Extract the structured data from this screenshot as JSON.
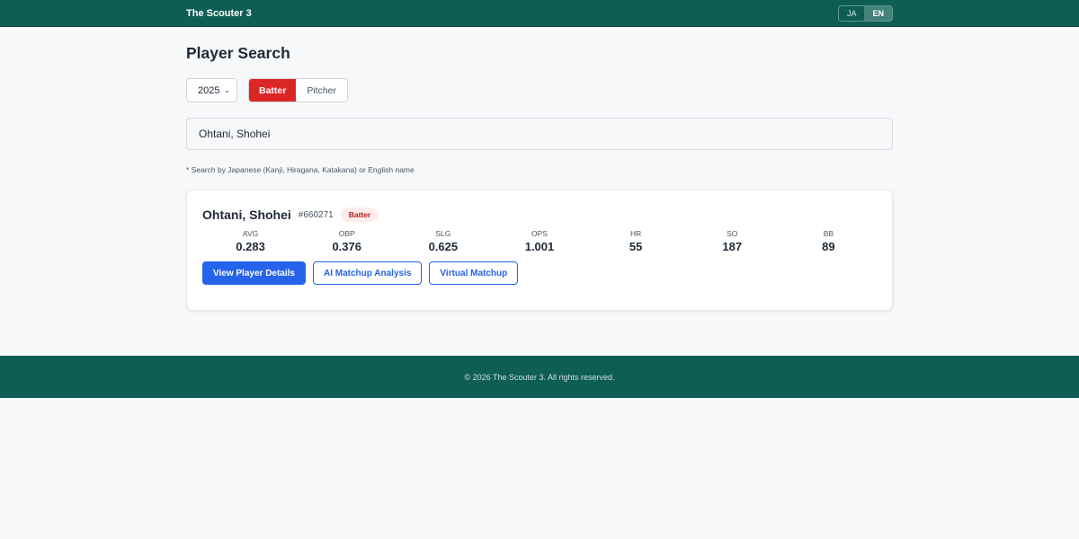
{
  "header": {
    "brand": "The Scouter 3",
    "languages": [
      {
        "label": "JA",
        "active": false
      },
      {
        "label": "EN",
        "active": true
      }
    ]
  },
  "page": {
    "title": "Player Search"
  },
  "controls": {
    "year": "2025",
    "types": [
      {
        "label": "Batter",
        "active": true
      },
      {
        "label": "Pitcher",
        "active": false
      }
    ]
  },
  "search": {
    "value": "Ohtani, Shohei",
    "hint": "* Search by Japanese (Kanji, Hiragana, Katakana) or English name"
  },
  "result": {
    "name": "Ohtani, Shohei",
    "id": "#660271",
    "badge": "Batter",
    "stats": [
      {
        "label": "AVG",
        "value": "0.283"
      },
      {
        "label": "OBP",
        "value": "0.376"
      },
      {
        "label": "SLG",
        "value": "0.625"
      },
      {
        "label": "OPS",
        "value": "1.001"
      },
      {
        "label": "HR",
        "value": "55"
      },
      {
        "label": "SO",
        "value": "187"
      },
      {
        "label": "BB",
        "value": "89"
      }
    ],
    "actions": {
      "details": "View Player Details",
      "ai": "AI Matchup Analysis",
      "virtual": "Virtual Matchup"
    }
  },
  "footer": {
    "text": "© 2026 The Scouter 3. All rights reserved."
  },
  "colors": {
    "header_bg": "#0f5e56",
    "batter_active": "#dc2626",
    "primary": "#2563eb"
  },
  "icons": {
    "year_dropdown": "chevron-down-icon"
  }
}
